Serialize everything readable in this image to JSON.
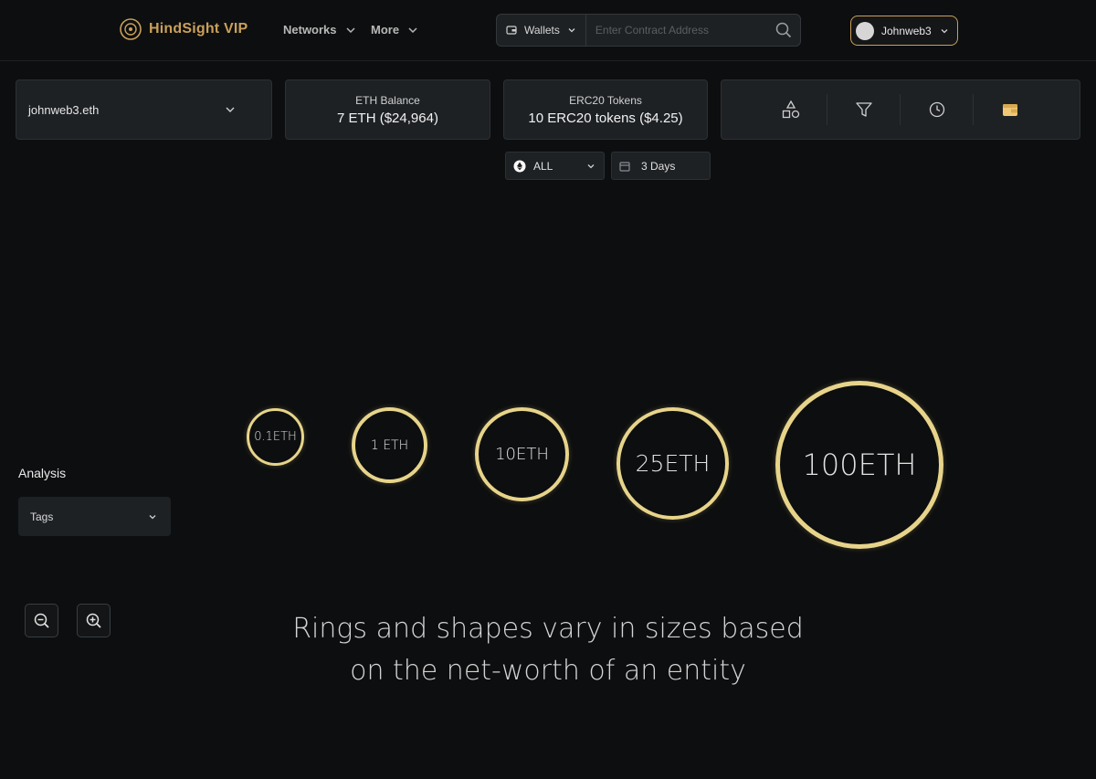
{
  "header": {
    "brand": "HindSight VIP",
    "nav": [
      {
        "label": "Networks"
      },
      {
        "label": "More"
      }
    ],
    "wallet_select": "Wallets",
    "search_placeholder": "Enter Contract Address",
    "user": "Johnweb3"
  },
  "cards": {
    "ens": "johnweb3.eth",
    "eth_balance": {
      "label": "ETH Balance",
      "value": "7 ETH ($24,964)"
    },
    "erc20": {
      "label": "ERC20 Tokens",
      "value": "10 ERC20 tokens ($4.25)"
    }
  },
  "tools": [
    "shapes-icon",
    "filter-icon",
    "clock-icon",
    "wallet-icon"
  ],
  "filters": {
    "network": "ALL",
    "range": "3 Days"
  },
  "analysis": {
    "title": "Analysis",
    "tags": "Tags"
  },
  "rings": [
    "0.1ETH",
    "1 ETH",
    "10ETH",
    "25ETH",
    "100ETH"
  ],
  "caption": {
    "line1": "Rings and shapes vary in sizes based",
    "line2": "on the net-worth of an entity"
  },
  "colors": {
    "accent": "#c9a05a",
    "ring": "#e7d48a",
    "background": "#0d0e0f",
    "panel": "#1e2124"
  }
}
